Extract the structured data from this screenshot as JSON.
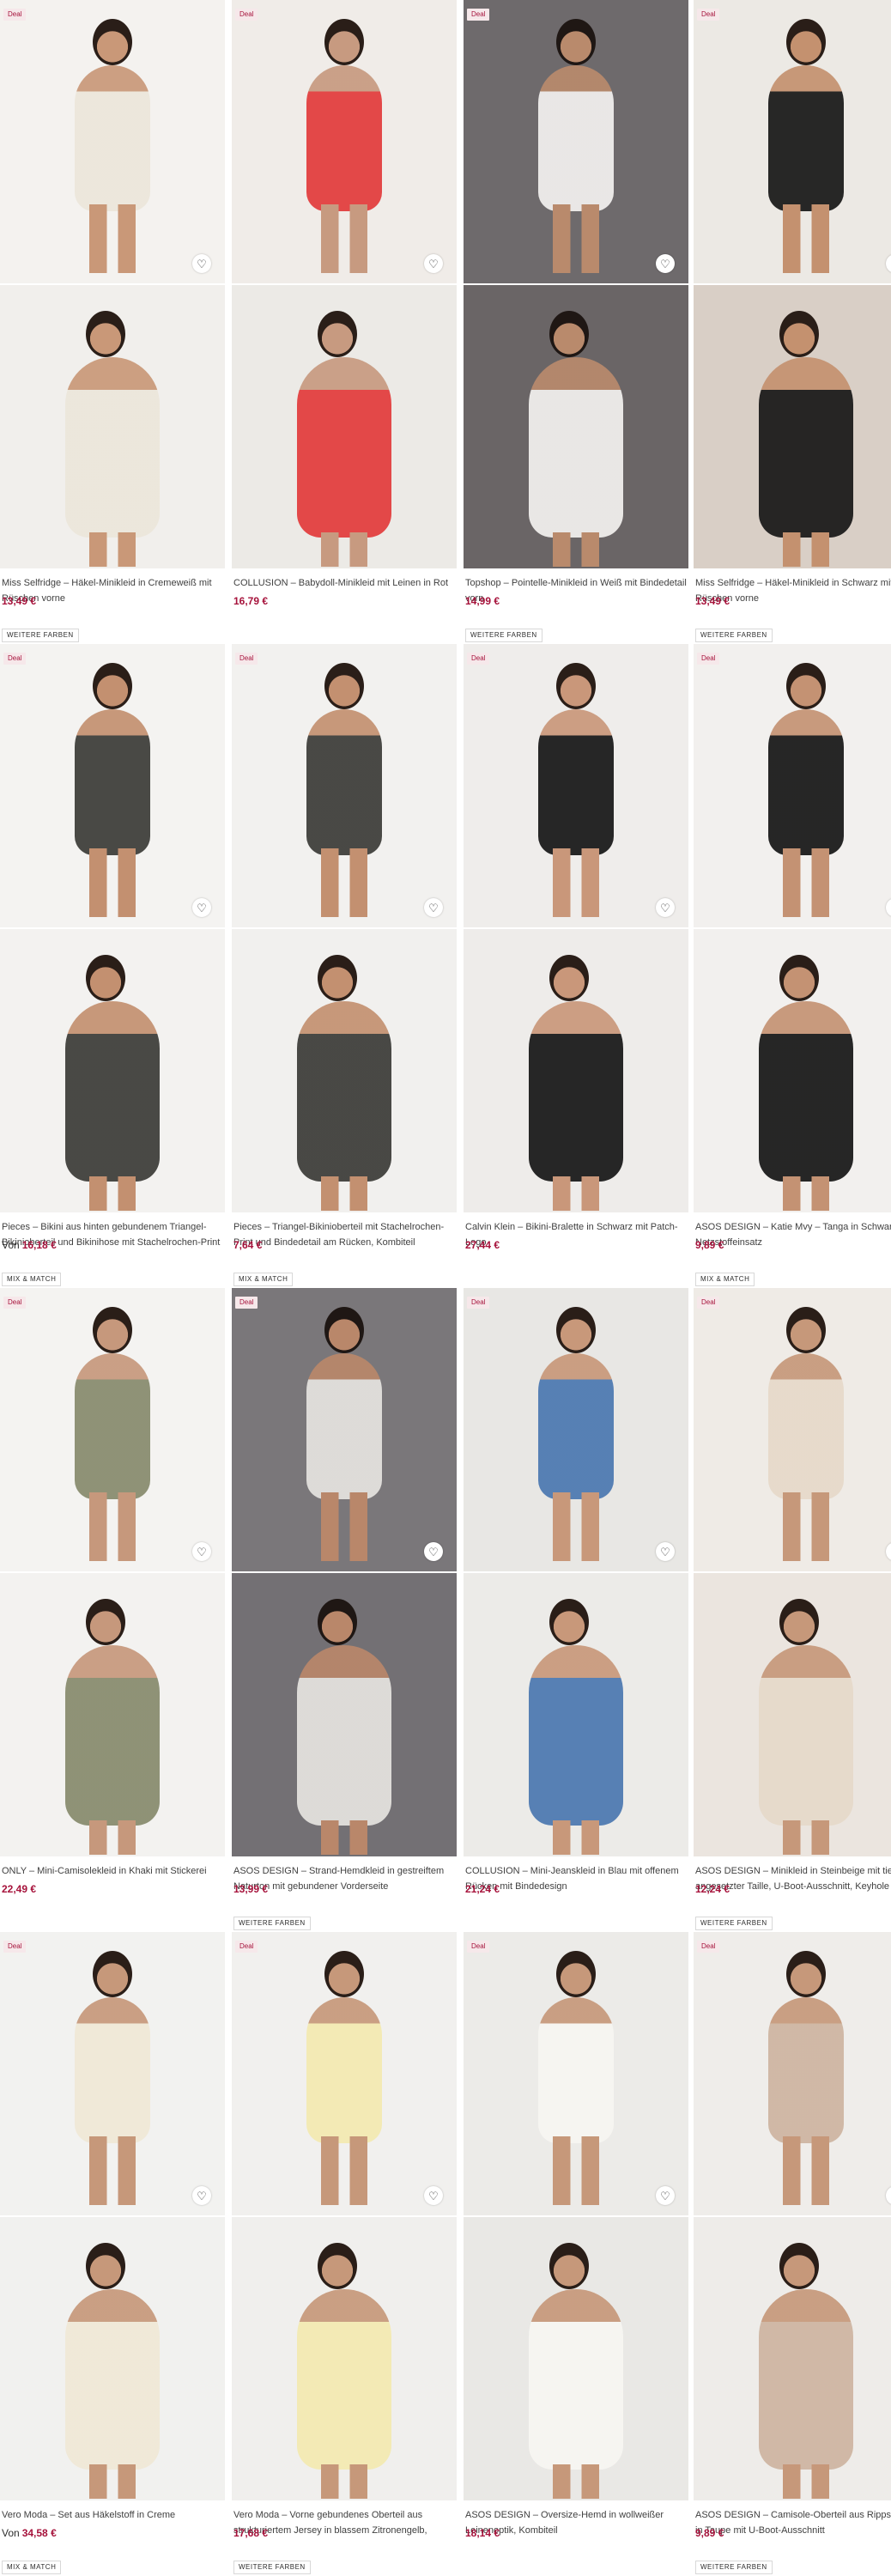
{
  "icons": {
    "wishlist": "heart-outline-icon"
  },
  "rows": [
    {
      "products": [
        {
          "badge": "Deal",
          "title": "Miss Selfridge – Häkel-Minikleid in Cremeweiß mit Rüschen vorne",
          "price_from": "",
          "price": "13,49 €",
          "tag": "WEITERE FARBEN",
          "colors": {
            "top_bg": "#f4f2ef",
            "bottom_bg": "#f1efec",
            "garment": "#ece6da",
            "skin": "#c99878",
            "hair": "#2a1e18"
          }
        },
        {
          "badge": "Deal",
          "title": "COLLUSION – Babydoll-Minikleid mit Leinen in Rot",
          "price_from": "",
          "price": "16,79 €",
          "tag": "",
          "colors": {
            "top_bg": "#f0ece8",
            "bottom_bg": "#eceae6",
            "garment": "#e23a3a",
            "skin": "#c79a80",
            "hair": "#2a1e18"
          }
        },
        {
          "badge": "Deal",
          "title": "Topshop – Pointelle-Minikleid in Weiß mit Bindedetail vorn",
          "price_from": "",
          "price": "14,99 €",
          "tag": "WEITERE FARBEN",
          "colors": {
            "top_bg": "#6e6a6c",
            "bottom_bg": "#6a6566",
            "garment": "#f4f2f0",
            "skin": "#b98a6c",
            "hair": "#1f1714"
          }
        },
        {
          "badge": "Deal",
          "title": "Miss Selfridge – Häkel-Minikleid in Schwarz mit Rüschen vorne",
          "price_from": "",
          "price": "13,49 €",
          "tag": "WEITERE FARBEN",
          "colors": {
            "top_bg": "#ece9e4",
            "bottom_bg": "#d9cfc6",
            "garment": "#161616",
            "skin": "#c4916f",
            "hair": "#2a1e18"
          }
        }
      ]
    },
    {
      "products": [
        {
          "badge": "Deal",
          "title": "Pieces – Bikini aus hinten gebundenem Triangel-Bikinioberteil und Bikinihose mit Stachelrochen-Print",
          "price_from": "Von",
          "price": "16,18 €",
          "tag": "MIX & MATCH",
          "colors": {
            "top_bg": "#f4f3f1",
            "bottom_bg": "#f3f2f0",
            "garment": "#3a3a36",
            "skin": "#c39070",
            "hair": "#2a1e18"
          }
        },
        {
          "badge": "Deal",
          "title": "Pieces – Triangel-Bikinioberteil mit Stachelrochen-Print und Bindedetail am Rücken, Kombiteil",
          "price_from": "",
          "price": "7,64 €",
          "tag": "MIX & MATCH",
          "colors": {
            "top_bg": "#f2f1ef",
            "bottom_bg": "#f1f0ee",
            "garment": "#3a3a36",
            "skin": "#c39070",
            "hair": "#2a1e18"
          }
        },
        {
          "badge": "Deal",
          "title": "Calvin Klein – Bikini-Bralette in Schwarz mit Patch-Logo",
          "price_from": "",
          "price": "27,44 €",
          "tag": "",
          "colors": {
            "top_bg": "#efedeb",
            "bottom_bg": "#eeecea",
            "garment": "#151515",
            "skin": "#c9977a",
            "hair": "#2a1e18"
          }
        },
        {
          "badge": "Deal",
          "title": "ASOS DESIGN – Katie Mvy – Tanga in Schwarz aus Netzstoffeinsatz",
          "price_from": "",
          "price": "9,89 €",
          "tag": "MIX & MATCH",
          "colors": {
            "top_bg": "#f2f0ee",
            "bottom_bg": "#f2f0ee",
            "garment": "#141414",
            "skin": "#c49273",
            "hair": "#2a1e18"
          }
        }
      ]
    },
    {
      "products": [
        {
          "badge": "Deal",
          "title": "ONLY – Mini-Camisolekleid in Khaki mit Stickerei",
          "price_from": "",
          "price": "22,49 €",
          "tag": "",
          "colors": {
            "top_bg": "#f4f3f1",
            "bottom_bg": "#f3f2f0",
            "garment": "#868a6c",
            "skin": "#c6987c",
            "hair": "#2a1e18"
          }
        },
        {
          "badge": "Deal",
          "title": "ASOS DESIGN – Strand-Hemdkleid in gestreiftem Naturton mit gebundener Vorderseite",
          "price_from": "",
          "price": "13,99 €",
          "tag": "WEITERE FARBEN",
          "colors": {
            "top_bg": "#7a777a",
            "bottom_bg": "#737074",
            "garment": "#e6e4e0",
            "skin": "#b9876a",
            "hair": "#1f1714"
          }
        },
        {
          "badge": "Deal",
          "title": "COLLUSION – Mini-Jeanskleid in Blau mit offenem Rücken mit Bindedesign",
          "price_from": "",
          "price": "21,24 €",
          "tag": "",
          "colors": {
            "top_bg": "#e8e7e4",
            "bottom_bg": "#ecebe8",
            "garment": "#4a77b0",
            "skin": "#c8987a",
            "hair": "#2a1e18"
          }
        },
        {
          "badge": "Deal",
          "title": "ASOS DESIGN – Minikleid in Steinbeige mit tief angesetzter Taille, U-Boot-Ausschnitt, Keyhole",
          "price_from": "",
          "price": "12,24 €",
          "tag": "WEITERE FARBEN",
          "colors": {
            "top_bg": "#efebe6",
            "bottom_bg": "#ebe5df",
            "garment": "#e6d9c9",
            "skin": "#c6987a",
            "hair": "#2a1e18"
          }
        }
      ]
    },
    {
      "products": [
        {
          "badge": "Deal",
          "title": "Vero Moda – Set aus Häkelstoff in Creme",
          "price_from": "Von",
          "price": "34,58 €",
          "tag": "MIX & MATCH",
          "colors": {
            "top_bg": "#f2f2f0",
            "bottom_bg": "#f1f1ef",
            "garment": "#f0e8d6",
            "skin": "#c6987a",
            "hair": "#2a1e18"
          }
        },
        {
          "badge": "Deal",
          "title": "Vero Moda – Vorne gebundenes Oberteil aus strukturiertem Jersey in blassem Zitronengelb, Kombiteil",
          "price_from": "",
          "price": "17,68 €",
          "tag": "WEITERE FARBEN",
          "colors": {
            "top_bg": "#f1f0ee",
            "bottom_bg": "#f0efed",
            "garment": "#f3eab0",
            "skin": "#c6987a",
            "hair": "#2a1e18"
          }
        },
        {
          "badge": "Deal",
          "title": "ASOS DESIGN – Oversize-Hemd in wollweißer Leinenoptik, Kombiteil",
          "price_from": "",
          "price": "18,14 €",
          "tag": "",
          "colors": {
            "top_bg": "#ecebe8",
            "bottom_bg": "#e9e8e5",
            "garment": "#f7f6f2",
            "skin": "#c6987a",
            "hair": "#2a1e18"
          }
        },
        {
          "badge": "Deal",
          "title": "ASOS DESIGN – Camisole-Oberteil aus Rippstrick in Taupe mit U-Boot-Ausschnitt",
          "price_from": "",
          "price": "9,89 €",
          "tag": "WEITERE FARBEN",
          "colors": {
            "top_bg": "#efedea",
            "bottom_bg": "#eeece9",
            "garment": "#cdb4a0",
            "skin": "#c6987a",
            "hair": "#2a1e18"
          }
        }
      ]
    }
  ]
}
